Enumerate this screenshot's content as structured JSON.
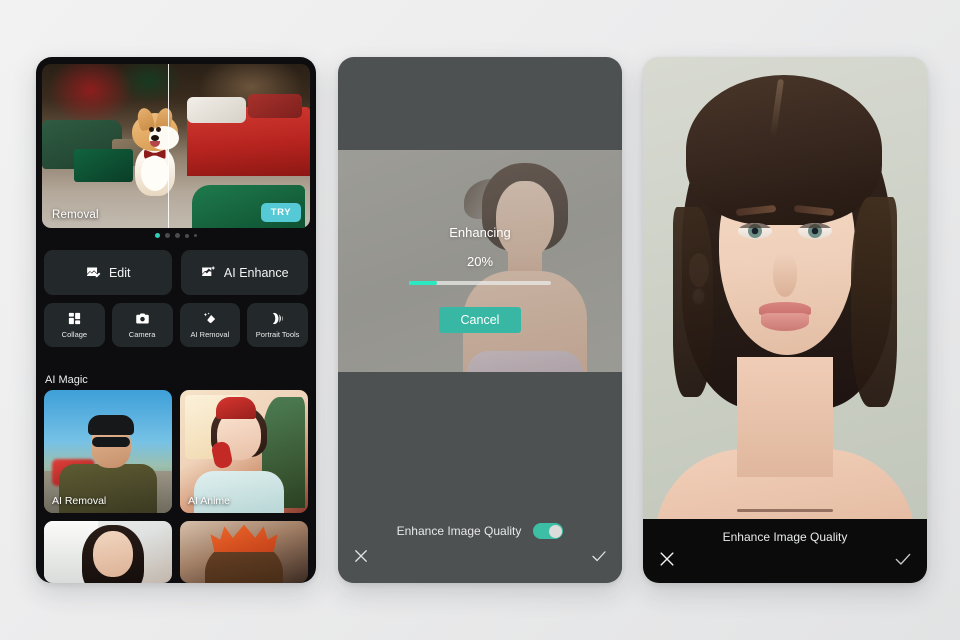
{
  "app": {
    "accent_teal": "#37b7a4",
    "accent_bright": "#2ce8c0",
    "try_button_color": "#56c9d6",
    "panel_dark_bg": "#0d0d0f",
    "panel_grey_bg": "#4d5152"
  },
  "panel1": {
    "name": "home-screen",
    "banner": {
      "label": "Removal",
      "try_label": "TRY",
      "dots_total": 5,
      "active_dot": 1
    },
    "actions": [
      {
        "label": "Edit",
        "icon": "image-edit-icon"
      },
      {
        "label": "AI Enhance",
        "icon": "image-sparkle-icon"
      }
    ],
    "tools": [
      {
        "label": "Collage",
        "icon": "collage-grid-icon"
      },
      {
        "label": "Camera",
        "icon": "camera-icon"
      },
      {
        "label": "AI Removal",
        "icon": "eraser-sparkle-icon"
      },
      {
        "label": "Portrait Tools",
        "icon": "portrait-lines-icon"
      }
    ],
    "section_title": "AI Magic",
    "cards": [
      {
        "label": "AI Removal"
      },
      {
        "label": "AI Anime"
      },
      {
        "label": ""
      },
      {
        "label": ""
      }
    ]
  },
  "panel2": {
    "name": "enhancing-progress-screen",
    "dialog": {
      "title": "Enhancing",
      "percent_label": "20%",
      "progress_value": 20,
      "cancel_label": "Cancel"
    },
    "bottom_bar": {
      "toggle_label": "Enhance Image Quality",
      "toggle_on": true,
      "close_icon": "close-x-icon",
      "confirm_icon": "check-icon"
    }
  },
  "panel3": {
    "name": "enhanced-result-screen",
    "bottom_bar": {
      "title": "Enhance Image Quality",
      "close_icon": "close-x-icon",
      "confirm_icon": "check-icon"
    }
  }
}
